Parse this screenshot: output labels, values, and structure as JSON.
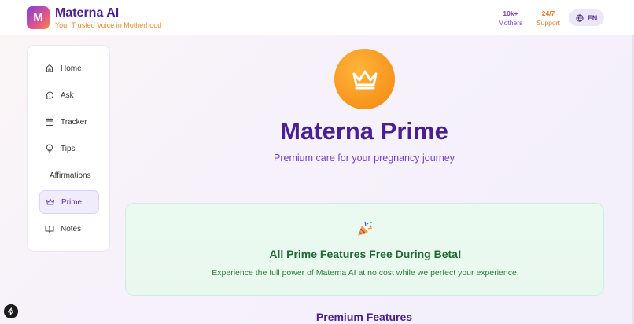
{
  "header": {
    "logo_letter": "M",
    "title": "Materna AI",
    "tagline": "Your Trusted Voice in Motherhood",
    "stats": [
      {
        "value": "10k+",
        "label": "Mothers"
      },
      {
        "value": "24/7",
        "label": "Support"
      }
    ],
    "language": "EN"
  },
  "sidebar": {
    "items": [
      {
        "label": "Home",
        "icon": "home-icon"
      },
      {
        "label": "Ask",
        "icon": "chat-bubble-icon"
      },
      {
        "label": "Tracker",
        "icon": "calendar-icon"
      },
      {
        "label": "Tips",
        "icon": "lightbulb-icon"
      },
      {
        "label": "Affirmations",
        "icon": ""
      },
      {
        "label": "Prime",
        "icon": "crown-icon",
        "active": true
      },
      {
        "label": "Notes",
        "icon": "book-icon"
      }
    ]
  },
  "main": {
    "title": "Materna Prime",
    "subtitle": "Premium care for your pregnancy journey",
    "beta_card": {
      "icon": "party-popper-icon",
      "title": "All Prime Features Free During Beta!",
      "text": "Experience the full power of Materna AI at no cost while we perfect your experience."
    },
    "section_title": "Premium Features"
  },
  "colors": {
    "brand_purple": "#4a1f8f",
    "accent_orange": "#f7941d",
    "success_green": "#1f6a2f"
  }
}
